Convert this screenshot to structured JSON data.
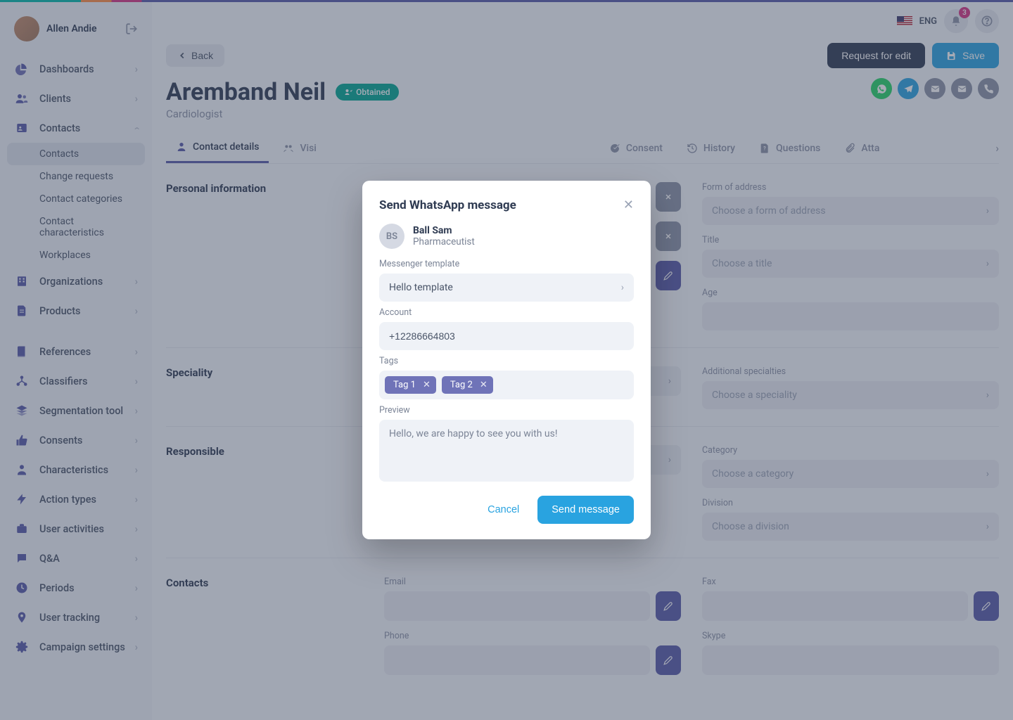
{
  "user": {
    "name": "Allen Andie"
  },
  "lang": "ENG",
  "notification_count": "3",
  "sidebar": {
    "items": [
      {
        "label": "Dashboards"
      },
      {
        "label": "Clients"
      },
      {
        "label": "Contacts"
      },
      {
        "label": "Organizations"
      },
      {
        "label": "Products"
      },
      {
        "label": "References"
      },
      {
        "label": "Classifiers"
      },
      {
        "label": "Segmentation tool"
      },
      {
        "label": "Consents"
      },
      {
        "label": "Characteristics"
      },
      {
        "label": "Action types"
      },
      {
        "label": "User activities"
      },
      {
        "label": "Q&A"
      },
      {
        "label": "Periods"
      },
      {
        "label": "User tracking"
      },
      {
        "label": "Campaign settings"
      }
    ],
    "contacts_sub": [
      {
        "label": "Contacts"
      },
      {
        "label": "Change requests"
      },
      {
        "label": "Contact categories"
      },
      {
        "label": "Contact characteristics"
      },
      {
        "label": "Workplaces"
      }
    ]
  },
  "page": {
    "back": "Back",
    "request_edit": "Request for edit",
    "save": "Save",
    "contact_name": "Aremband Neil",
    "contact_role": "Cardiologist",
    "status": "Obtained"
  },
  "tabs": [
    "Contact details",
    "Visi",
    "",
    "",
    "Consent",
    "History",
    "Questions",
    "Atta"
  ],
  "sections": {
    "personal": "Personal information",
    "speciality": "Speciality",
    "responsible": "Responsible",
    "contacts": "Contacts"
  },
  "fields": {
    "form_of_address": {
      "label": "Form of address",
      "placeholder": "Choose a form of address"
    },
    "title": {
      "label": "Title",
      "placeholder": "Choose a title"
    },
    "age": {
      "label": "Age"
    },
    "addl_spec": {
      "label": "Additional specialties",
      "placeholder": "Choose a speciality"
    },
    "category": {
      "label": "Category",
      "placeholder": "Choose a category"
    },
    "division": {
      "label": "Division",
      "placeholder": "Choose a division"
    },
    "email": {
      "label": "Email"
    },
    "fax": {
      "label": "Fax"
    },
    "phone": {
      "label": "Phone"
    },
    "skype": {
      "label": "Skype"
    }
  },
  "modal": {
    "title": "Send WhatsApp message",
    "user_initials": "BS",
    "user_name": "Ball Sam",
    "user_role": "Pharmaceutist",
    "template_label": "Messenger template",
    "template_value": "Hello template",
    "account_label": "Account",
    "account_value": "+12286664803",
    "tags_label": "Tags",
    "tags": [
      "Tag 1",
      "Tag 2"
    ],
    "preview_label": "Preview",
    "preview_text": "Hello, we are happy to see you with us!",
    "cancel": "Cancel",
    "send": "Send message"
  }
}
